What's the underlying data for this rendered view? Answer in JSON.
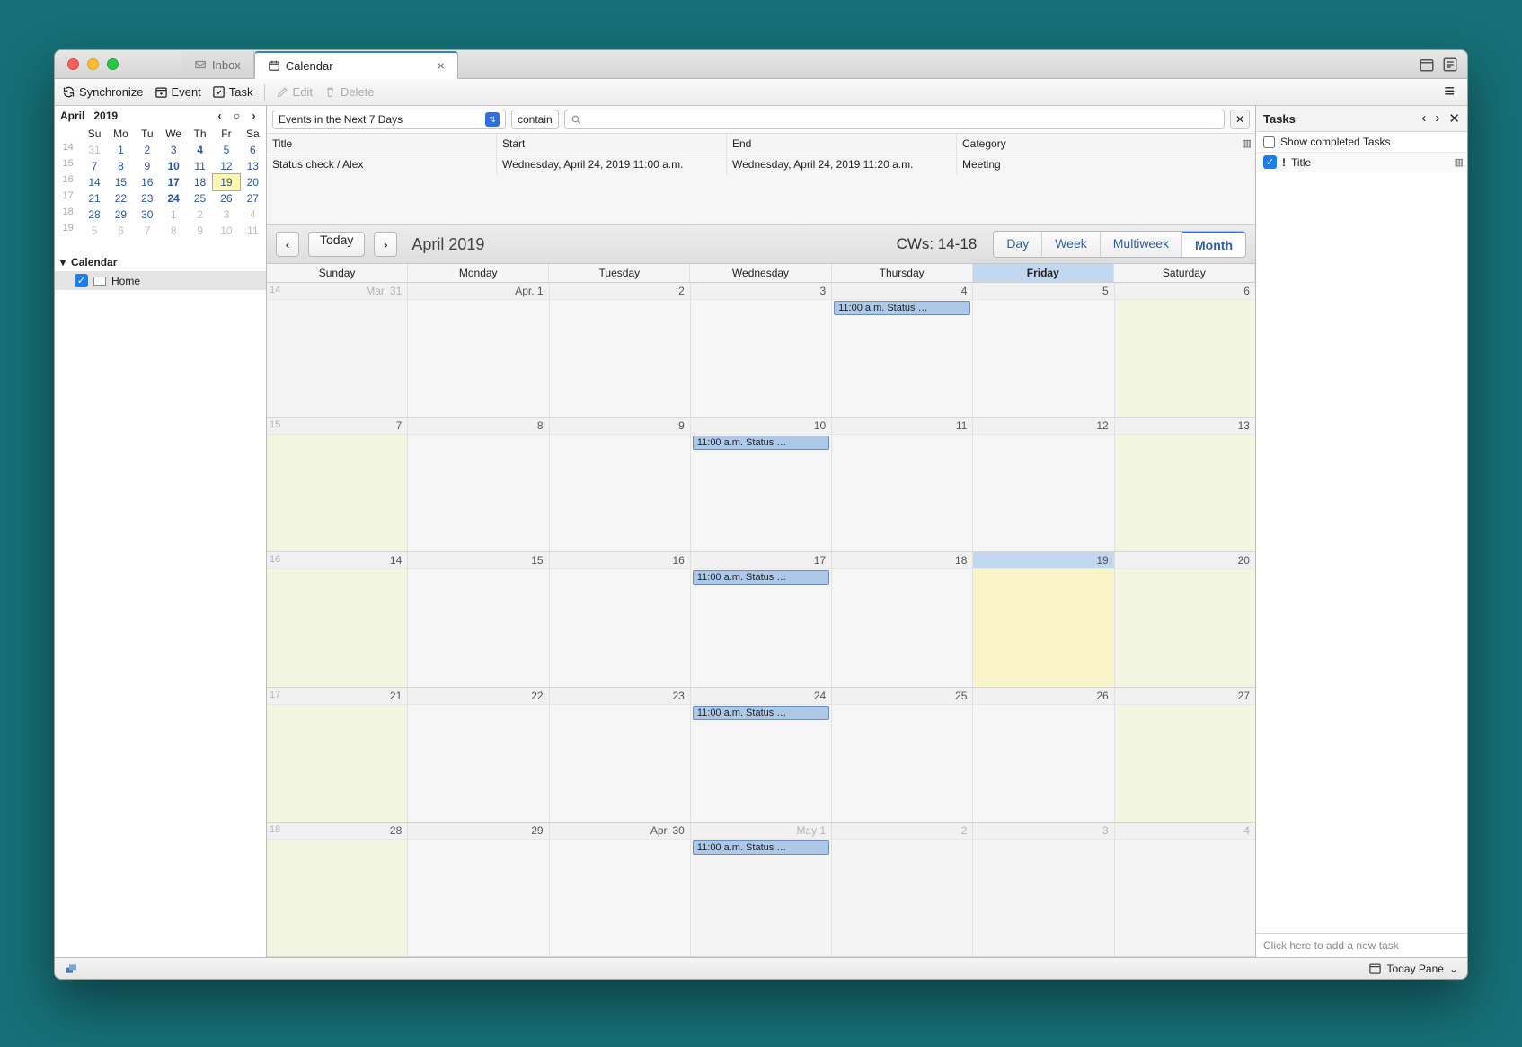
{
  "tabs": {
    "inbox": "Inbox",
    "calendar": "Calendar"
  },
  "toolbar": {
    "sync": "Synchronize",
    "event": "Event",
    "task": "Task",
    "edit": "Edit",
    "delete": "Delete"
  },
  "mini": {
    "month": "April",
    "year": "2019",
    "dow": [
      "Su",
      "Mo",
      "Tu",
      "We",
      "Th",
      "Fr",
      "Sa"
    ],
    "weeks": [
      {
        "wn": "14",
        "d": [
          "31",
          "1",
          "2",
          "3",
          "4",
          "5",
          "6"
        ],
        "dim": [
          0
        ],
        "bold": [
          4
        ]
      },
      {
        "wn": "15",
        "d": [
          "7",
          "8",
          "9",
          "10",
          "11",
          "12",
          "13"
        ],
        "bold": [
          3
        ]
      },
      {
        "wn": "16",
        "d": [
          "14",
          "15",
          "16",
          "17",
          "18",
          "19",
          "20"
        ],
        "bold": [
          3
        ],
        "today": 5
      },
      {
        "wn": "17",
        "d": [
          "21",
          "22",
          "23",
          "24",
          "25",
          "26",
          "27"
        ],
        "bold": [
          3
        ]
      },
      {
        "wn": "18",
        "d": [
          "28",
          "29",
          "30",
          "1",
          "2",
          "3",
          "4"
        ],
        "dim": [
          3,
          4,
          5,
          6
        ]
      },
      {
        "wn": "19",
        "d": [
          "5",
          "6",
          "7",
          "8",
          "9",
          "10",
          "11"
        ],
        "dim": [
          0,
          1,
          2,
          3,
          4,
          5,
          6
        ]
      }
    ]
  },
  "tree": {
    "header": "Calendar",
    "item": "Home"
  },
  "filter": {
    "scope": "Events in the Next 7 Days",
    "mode": "contain"
  },
  "evcols": {
    "title": "Title",
    "start": "Start",
    "end": "End",
    "cat": "Category"
  },
  "evrow": {
    "title": "Status check / Alex",
    "start": "Wednesday, April 24, 2019 11:00 a.m.",
    "end": "Wednesday, April 24, 2019 11:20 a.m.",
    "cat": "Meeting"
  },
  "monthnav": {
    "today": "Today",
    "title": "April 2019",
    "cws": "CWs: 14-18",
    "views": [
      "Day",
      "Week",
      "Multiweek",
      "Month"
    ],
    "active": "Month"
  },
  "dow_full": [
    "Sunday",
    "Monday",
    "Tuesday",
    "Wednesday",
    "Thursday",
    "Friday",
    "Saturday"
  ],
  "grid": [
    {
      "wn": "14",
      "days": [
        {
          "n": "Mar. 31",
          "off": true
        },
        {
          "n": "Apr. 1"
        },
        {
          "n": "2"
        },
        {
          "n": "3"
        },
        {
          "n": "4",
          "ev": "11:00 a.m. Status …"
        },
        {
          "n": "5"
        },
        {
          "n": "6",
          "we": true
        }
      ]
    },
    {
      "wn": "15",
      "days": [
        {
          "n": "7",
          "we": true
        },
        {
          "n": "8"
        },
        {
          "n": "9"
        },
        {
          "n": "10",
          "ev": "11:00 a.m. Status …"
        },
        {
          "n": "11"
        },
        {
          "n": "12"
        },
        {
          "n": "13",
          "we": true
        }
      ]
    },
    {
      "wn": "16",
      "days": [
        {
          "n": "14",
          "we": true
        },
        {
          "n": "15"
        },
        {
          "n": "16"
        },
        {
          "n": "17",
          "ev": "11:00 a.m. Status …"
        },
        {
          "n": "18"
        },
        {
          "n": "19",
          "tday": true
        },
        {
          "n": "20",
          "we": true
        }
      ]
    },
    {
      "wn": "17",
      "days": [
        {
          "n": "21",
          "we": true
        },
        {
          "n": "22"
        },
        {
          "n": "23"
        },
        {
          "n": "24",
          "ev": "11:00 a.m. Status …"
        },
        {
          "n": "25"
        },
        {
          "n": "26"
        },
        {
          "n": "27",
          "we": true
        }
      ]
    },
    {
      "wn": "18",
      "days": [
        {
          "n": "28",
          "we": true
        },
        {
          "n": "29"
        },
        {
          "n": "Apr. 30"
        },
        {
          "n": "May 1",
          "ev": "11:00 a.m. Status …",
          "off": true
        },
        {
          "n": "2",
          "off": true
        },
        {
          "n": "3",
          "off": true
        },
        {
          "n": "4",
          "off": true
        }
      ]
    }
  ],
  "tasks": {
    "title": "Tasks",
    "showCompleted": "Show completed Tasks",
    "colTitle": "Title",
    "placeholder": "Click here to add a new task"
  },
  "status": {
    "todaypane": "Today Pane"
  }
}
